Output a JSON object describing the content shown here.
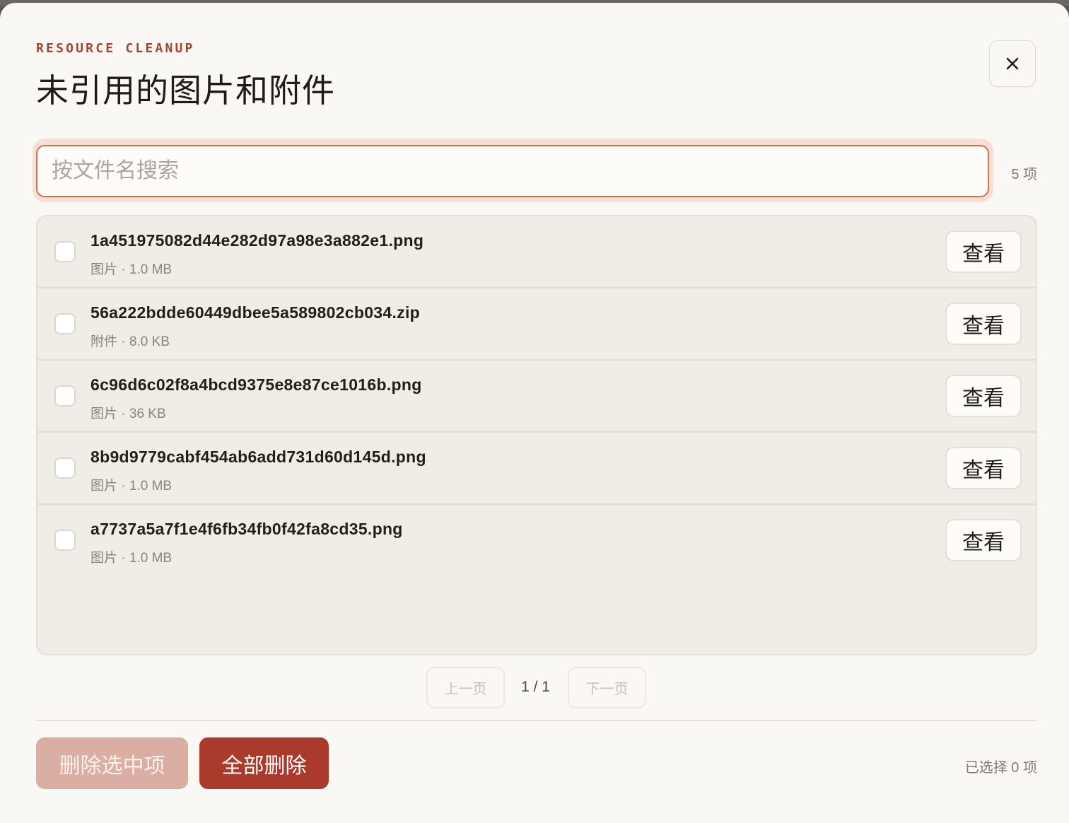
{
  "header": {
    "eyebrow": "RESOURCE CLEANUP",
    "title": "未引用的图片和附件"
  },
  "search": {
    "placeholder": "按文件名搜索",
    "value": "",
    "count_label": "5 项"
  },
  "files": [
    {
      "name": "1a451975082d44e282d97a98e3a882e1.png",
      "meta": "图片 · 1.0 MB",
      "checked": false,
      "action_label": "查看"
    },
    {
      "name": "56a222bdde60449dbee5a589802cb034.zip",
      "meta": "附件 · 8.0 KB",
      "checked": false,
      "action_label": "查看"
    },
    {
      "name": "6c96d6c02f8a4bcd9375e8e87ce1016b.png",
      "meta": "图片 · 36 KB",
      "checked": false,
      "action_label": "查看"
    },
    {
      "name": "8b9d9779cabf454ab6add731d60d145d.png",
      "meta": "图片 · 1.0 MB",
      "checked": false,
      "action_label": "查看"
    },
    {
      "name": "a7737a5a7f1e4f6fb34fb0f42fa8cd35.png",
      "meta": "图片 · 1.0 MB",
      "checked": false,
      "action_label": "查看"
    }
  ],
  "pagination": {
    "prev_label": "上一页",
    "indicator": "1 / 1",
    "next_label": "下一页",
    "prev_disabled": true,
    "next_disabled": true
  },
  "footer": {
    "delete_selected_label": "删除选中项",
    "delete_selected_disabled": true,
    "delete_all_label": "全部删除",
    "selected_status": "已选择 0 项"
  },
  "icons": {
    "close": "close-icon"
  },
  "colors": {
    "accent": "#a93a2c",
    "accent_disabled": "#dbaea4",
    "eyebrow": "#a8432d",
    "search_focus_border": "#d0724d",
    "panel_bg": "#f0ede6",
    "modal_bg": "#faf8f4"
  }
}
